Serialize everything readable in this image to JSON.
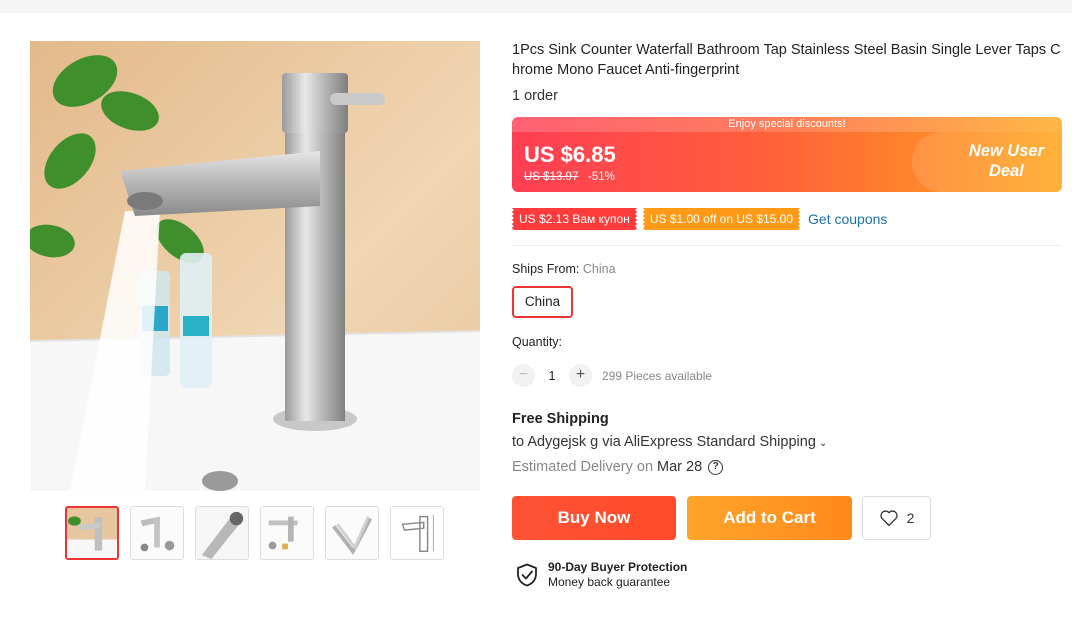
{
  "product": {
    "title": "1Pcs Sink Counter Waterfall Bathroom Tap Stainless Steel Basin Single Lever Taps Chrome Mono Faucet Anti-fingerprint",
    "orders": "1 order"
  },
  "price": {
    "banner": "Enjoy special discounts!",
    "current": "US $6.85",
    "original": "US $13.97",
    "discount": "-51%",
    "promo_line1": "New User",
    "promo_line2": "Deal"
  },
  "coupons": {
    "items": [
      "US $2.13 Вам купон",
      "US $1.00 off on US $15.00"
    ],
    "get_label": "Get coupons"
  },
  "shipping_from": {
    "label": "Ships From:",
    "value": "China",
    "option": "China"
  },
  "quantity": {
    "label": "Quantity:",
    "minus": "−",
    "value": "1",
    "plus": "+",
    "available": "299 Pieces available"
  },
  "delivery": {
    "free_shipping": "Free Shipping",
    "ship_to": "to Adygejsk g via AliExpress Standard Shipping",
    "estimated_label": "Estimated Delivery on",
    "estimated_date": "Mar 28",
    "help": "?"
  },
  "actions": {
    "buy_now": "Buy Now",
    "add_to_cart": "Add to Cart",
    "wishlist_count": "2"
  },
  "protection": {
    "title": "90-Day Buyer Protection",
    "subtitle": "Money back guarantee"
  },
  "icons": {
    "wishlist": "heart-icon",
    "protection": "shield-check-icon",
    "dropdown": "chevron-down-icon"
  },
  "colors": {
    "accent_red": "#ff4b2b",
    "accent_orange": "#ff8a1c",
    "link_blue": "#1a73a8"
  }
}
